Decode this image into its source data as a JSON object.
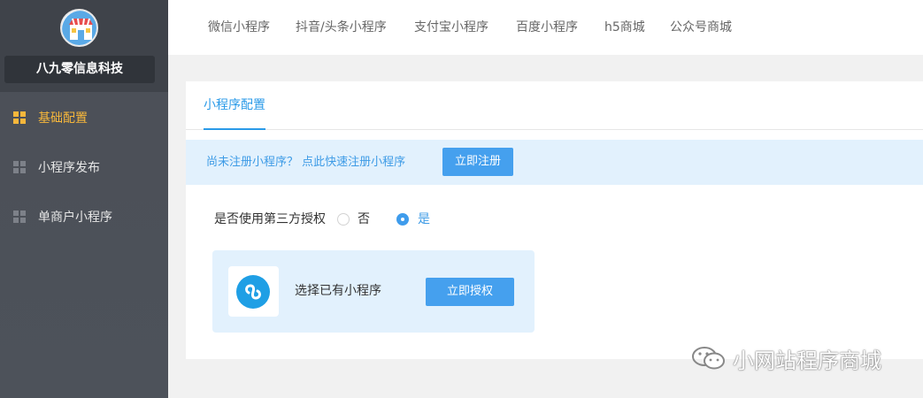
{
  "sidebar": {
    "brand_name": "八九零信息科技",
    "items": [
      {
        "label": "基础配置",
        "active": true
      },
      {
        "label": "小程序发布",
        "active": false
      },
      {
        "label": "单商户小程序",
        "active": false
      }
    ]
  },
  "topnav": {
    "items": [
      "微信小程序",
      "抖音/头条小程序",
      "支付宝小程序",
      "百度小程序",
      "h5商城",
      "公众号商城"
    ]
  },
  "card": {
    "tab_label": "小程序配置",
    "notice_text": "尚未注册小程序？ 点此快速注册小程序",
    "register_button": "立即注册",
    "auth_question": "是否使用第三方授权",
    "options": [
      {
        "label": "否",
        "checked": false
      },
      {
        "label": "是",
        "checked": true
      }
    ],
    "mini_program_text": "选择已有小程序",
    "authorize_button": "立即授权"
  },
  "watermark": {
    "text": "小网站程序商城"
  },
  "colors": {
    "sidebar_bg": "#4b4f57",
    "accent_active": "#f7b73b",
    "primary_blue": "#45a0ee",
    "link_blue": "#3d9be6",
    "notice_bg": "#e2f1fd"
  },
  "icons": {
    "avatar": "shop-store-icon",
    "nav": "grid-icon",
    "mini_program": "mini-program-logo-icon",
    "watermark": "wechat-icon"
  }
}
